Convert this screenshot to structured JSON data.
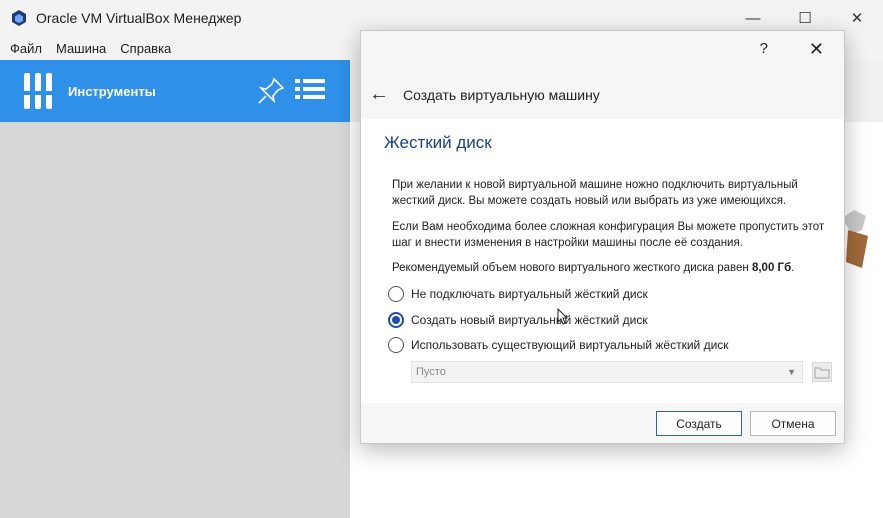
{
  "window": {
    "title": "Oracle VM VirtualBox Менеджер"
  },
  "menu": [
    "Файл",
    "Машина",
    "Справка"
  ],
  "tools": {
    "label": "Инструменты"
  },
  "dialog": {
    "help_label": "?",
    "title": "Создать виртуальную машину",
    "section_title": "Жесткий диск",
    "para1": "При желании к новой виртуальной машине ножно подключить виртуальный жесткий диск. Вы можете создать новый или выбрать из уже имеющихся.",
    "para2": "Если Вам необходима более сложная конфигурация Вы можете пропустить этот шаг и внести изменения в настройки машины после её создания.",
    "para3_prefix": "Рекомендуемый объем нового виртуального жесткого диска равен ",
    "para3_size": "8,00 Гб",
    "para3_suffix": ".",
    "options": [
      {
        "label": "Не подключать виртуальный жёсткий диск",
        "checked": false
      },
      {
        "label": "Создать новый виртуальный жёсткий диск",
        "checked": true
      },
      {
        "label": "Использовать существующий виртуальный жёсткий диск",
        "checked": false
      }
    ],
    "combo_value": "Пусто",
    "create_label": "Создать",
    "cancel_label": "Отмена"
  },
  "colors": {
    "accent": "#2e90e8",
    "section_title": "#1b3f8b"
  }
}
